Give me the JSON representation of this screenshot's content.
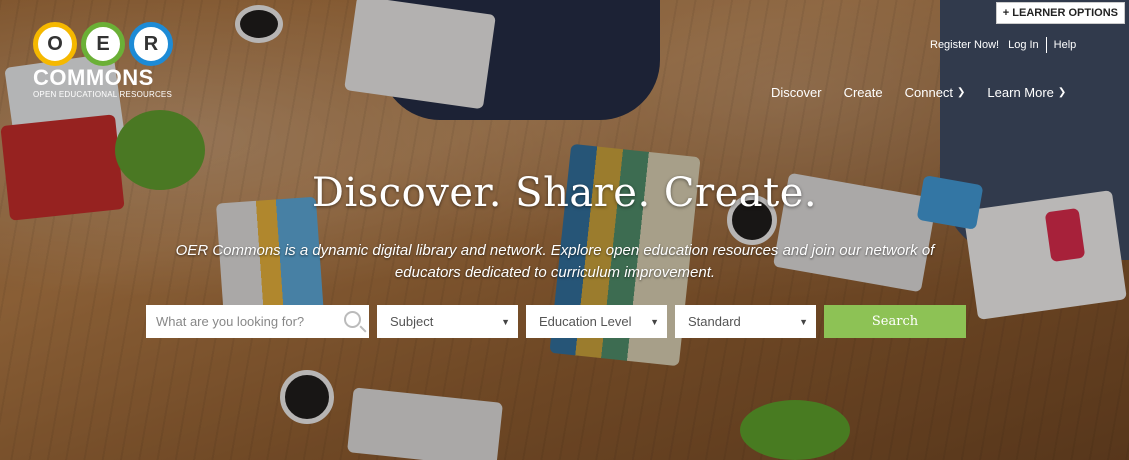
{
  "header": {
    "learner_options": "+ LEARNER OPTIONS",
    "links": {
      "register": "Register Now!",
      "login": "Log In",
      "help": "Help"
    }
  },
  "logo": {
    "letters": [
      "O",
      "E",
      "R"
    ],
    "word": "COMMONS",
    "tagline": "OPEN EDUCATIONAL RESOURCES"
  },
  "nav": {
    "items": [
      {
        "label": "Discover"
      },
      {
        "label": "Create"
      },
      {
        "label": "Connect",
        "dropdown": true
      },
      {
        "label": "Learn More",
        "dropdown": true
      }
    ]
  },
  "hero": {
    "headline": "Discover. Share. Create.",
    "subtext": "OER Commons is a dynamic digital library and network. Explore open education resources and join our network of educators dedicated to curriculum improvement."
  },
  "search": {
    "placeholder": "What are you looking for?",
    "subject": "Subject",
    "education_level": "Education Level",
    "standard": "Standard",
    "button": "Search"
  },
  "colors": {
    "search_button": "#8dc255",
    "logo_o": "#f5b800",
    "logo_e": "#6bb036",
    "logo_r": "#1d8bd6"
  }
}
